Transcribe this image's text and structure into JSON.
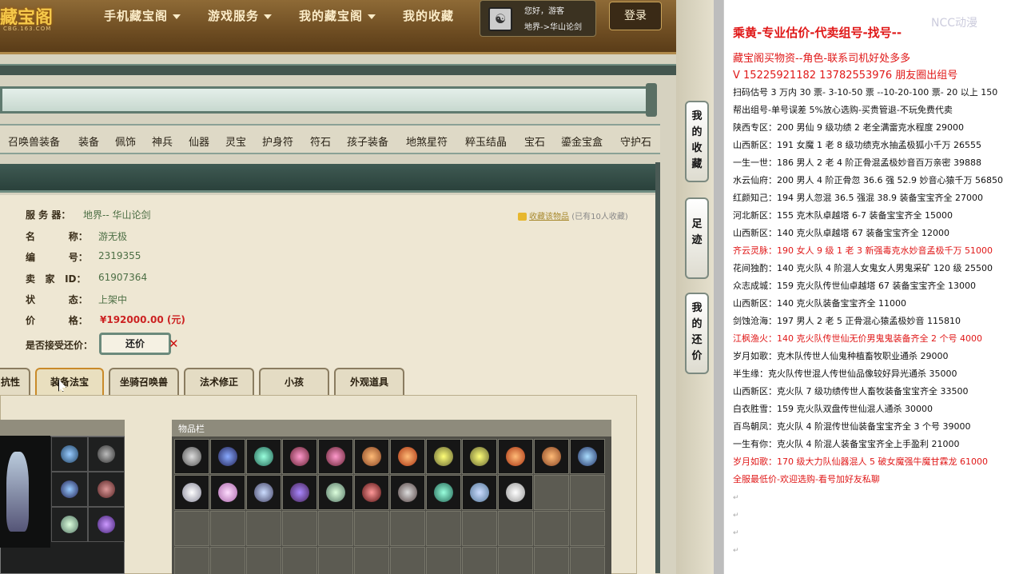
{
  "header": {
    "logo": "藏宝阁",
    "logo_sub": "CBG.163.COM",
    "nav": [
      {
        "label": "手机藏宝阁",
        "dropdown": true
      },
      {
        "label": "游戏服务",
        "dropdown": true
      },
      {
        "label": "我的藏宝阁",
        "dropdown": true
      },
      {
        "label": "我的收藏",
        "dropdown": false
      }
    ],
    "greeting": "您好，游客",
    "server_short": "地界->华山论剑",
    "login": "登录"
  },
  "categories": [
    "召唤兽装备",
    "装备",
    "佩饰",
    "神兵",
    "仙器",
    "灵宝",
    "护身符",
    "符石",
    "孩子装备",
    "地煞星符",
    "粹玉结晶",
    "宝石",
    "鎏金宝盒",
    "守护石"
  ],
  "detail": {
    "server_label": "服 务 器：",
    "server_value": "地界-- 华山论剑",
    "name_label": "名          称：",
    "name_value": "游无极",
    "id_label": "编          号：",
    "id_value": "2319355",
    "seller_label": "卖   家   ID：",
    "seller_value": "61907364",
    "status_label": "状          态：",
    "status_value": "上架中",
    "price_label": "价          格：",
    "price_value": "¥192000.00 (元)",
    "counter_label": "是否接受还价：",
    "counter_button": "还价",
    "fav_link": "收藏该物品",
    "fav_count": "(已有10人收藏)"
  },
  "tabs": [
    {
      "label": "抗性",
      "active": false
    },
    {
      "label": "装备法宝",
      "active": true
    },
    {
      "label": "坐骑召唤兽",
      "active": false
    },
    {
      "label": "法术修正",
      "active": false
    },
    {
      "label": "小孩",
      "active": false
    },
    {
      "label": "外观道具",
      "active": false
    }
  ],
  "items_header": "物品栏",
  "side_tabs": [
    "我的收藏",
    "足迹",
    "我的还价"
  ],
  "notes": {
    "watermark": "NCC动漫",
    "lines": [
      {
        "text": "乘黄-专业估价-代卖组号-找号--",
        "style": "big"
      },
      {
        "text": "藏宝阁买物资--角色-联系司机好处多多",
        "style": "mid"
      },
      {
        "text": "V 15225921182    13782553976 朋友圈出组号",
        "style": "mid"
      },
      {
        "text": "扫码估号 3 万内 30 票- 3-10-50 票  --10-20-100 票- 20 以上 150",
        "style": "normal"
      },
      {
        "text": "帮出组号-单号误差 5%放心选购-买贵管退-不玩免费代卖",
        "style": "normal"
      },
      {
        "text": "陕西专区：200 男仙 9 级功绩 2 老全满雷克水程度 29000",
        "style": "normal"
      },
      {
        "text": "山西新区：191 女魔 1 老 8 级功绩克水抽孟极狐小千万 26555",
        "style": "normal"
      },
      {
        "text": "一生一世：186 男人 2 老 4 阶正骨混孟极妙音百万亲密 39888",
        "style": "normal"
      },
      {
        "text": "水云仙府：200 男人 4 阶正骨忽 36.6 强 52.9 妙音心猿千万 56850",
        "style": "normal"
      },
      {
        "text": "红颜知己：194 男人忽混 36.5 强混 38.9 装备宝宝齐全 27000",
        "style": "normal"
      },
      {
        "text": "河北新区：155 克木队卓越塔 6-7 装备宝宝齐全 15000",
        "style": "normal"
      },
      {
        "text": "山西新区：140 克火队卓越塔 67 装备宝宝齐全 12000",
        "style": "normal"
      },
      {
        "text": "齐云灵脉：190 女人 9 级 1 老 3 新强毒克水妙音孟极千万 51000",
        "style": "red"
      },
      {
        "text": "花间独酌：140 克火队 4 阶混人女鬼女人男鬼采矿 120 级 25500",
        "style": "normal"
      },
      {
        "text": "众志成城：159 克火队传世仙卓越塔 67 装备宝宝齐全 13000",
        "style": "normal"
      },
      {
        "text": "山西新区：140 克火队装备宝宝齐全 11000",
        "style": "normal"
      },
      {
        "text": "剑蚀沧海：197 男人 2 老 5 正骨混心猿孟极妙音 115810",
        "style": "normal"
      },
      {
        "text": "江枫渔火：140 克火队传世仙无价男鬼鬼装备齐全 2 个号 4000",
        "style": "red"
      },
      {
        "text": "岁月如歌：克木队传世人仙鬼种植畜牧职业通杀 29000",
        "style": "normal"
      },
      {
        "text": "半生缘：克火队传世混人传世仙品像较好异光通杀 35000",
        "style": "normal"
      },
      {
        "text": "山西新区：克火队 7 级功绩传世人畜牧装备宝宝齐全 33500",
        "style": "normal"
      },
      {
        "text": "白衣胜雪：159 克火队双盘传世仙混人通杀 30000",
        "style": "normal"
      },
      {
        "text": "百鸟朝凤：克火队 4 阶混传世仙装备宝宝齐全 3 个号 39000",
        "style": "normal"
      },
      {
        "text": "一生有你：克火队 4 阶混人装备宝宝齐全上手盈利 21000",
        "style": "normal"
      },
      {
        "text": "岁月如歌：170 级大力队仙器混人 5 破女魔强牛魔甘霖龙 61000",
        "style": "red"
      },
      {
        "text": "全服最低价-欢迎选购-看号加好友私聊",
        "style": "red"
      }
    ]
  },
  "colors": {
    "accent_red": "#e01818",
    "value_green": "#4d6f45",
    "header_brown": "#6e4d22",
    "panel_teal": "#2a413b"
  }
}
